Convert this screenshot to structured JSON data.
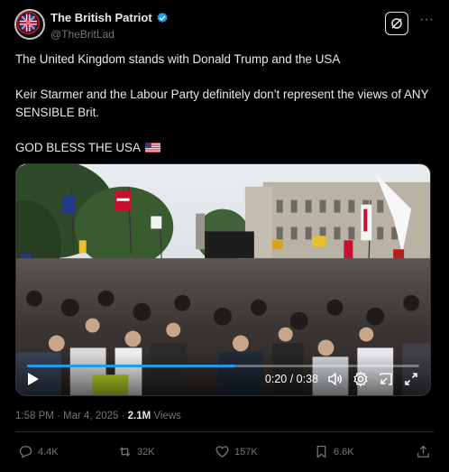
{
  "author": {
    "display_name": "The British Patriot",
    "handle": "@TheBritLad",
    "verified": true,
    "avatar_icon": "union-jack-crest-avatar"
  },
  "header_actions": {
    "grok_icon": "grok-icon",
    "more_label": "···"
  },
  "tweet": {
    "paragraphs": [
      "The United Kingdom stands with Donald Trump and the USA",
      "Keir Starmer and the Labour Party definitely don’t represent the views of ANY SENSIBLE Brit.",
      "GOD BLESS THE USA"
    ],
    "flag_icon": "us-flag-emoji"
  },
  "video": {
    "current_time": "0:20",
    "duration": "0:38",
    "time_label": "0:20 / 0:38",
    "progress_fraction": 0.53,
    "controls": [
      "play-icon",
      "volume-icon",
      "settings-icon",
      "picture-in-picture-icon",
      "fullscreen-icon"
    ]
  },
  "meta": {
    "timestamp": "1:58 PM · Mar 4, 2025",
    "separator": " · ",
    "views_count": "2.1M",
    "views_label": " Views"
  },
  "actions": {
    "replies": "4.4K",
    "reposts": "32K",
    "likes": "157K",
    "bookmarks": "6.6K"
  },
  "colors": {
    "background": "#000000",
    "text": "#e7e9ea",
    "secondary_text": "#71767b",
    "accent": "#1d9bf0",
    "divider": "#2f3336"
  }
}
